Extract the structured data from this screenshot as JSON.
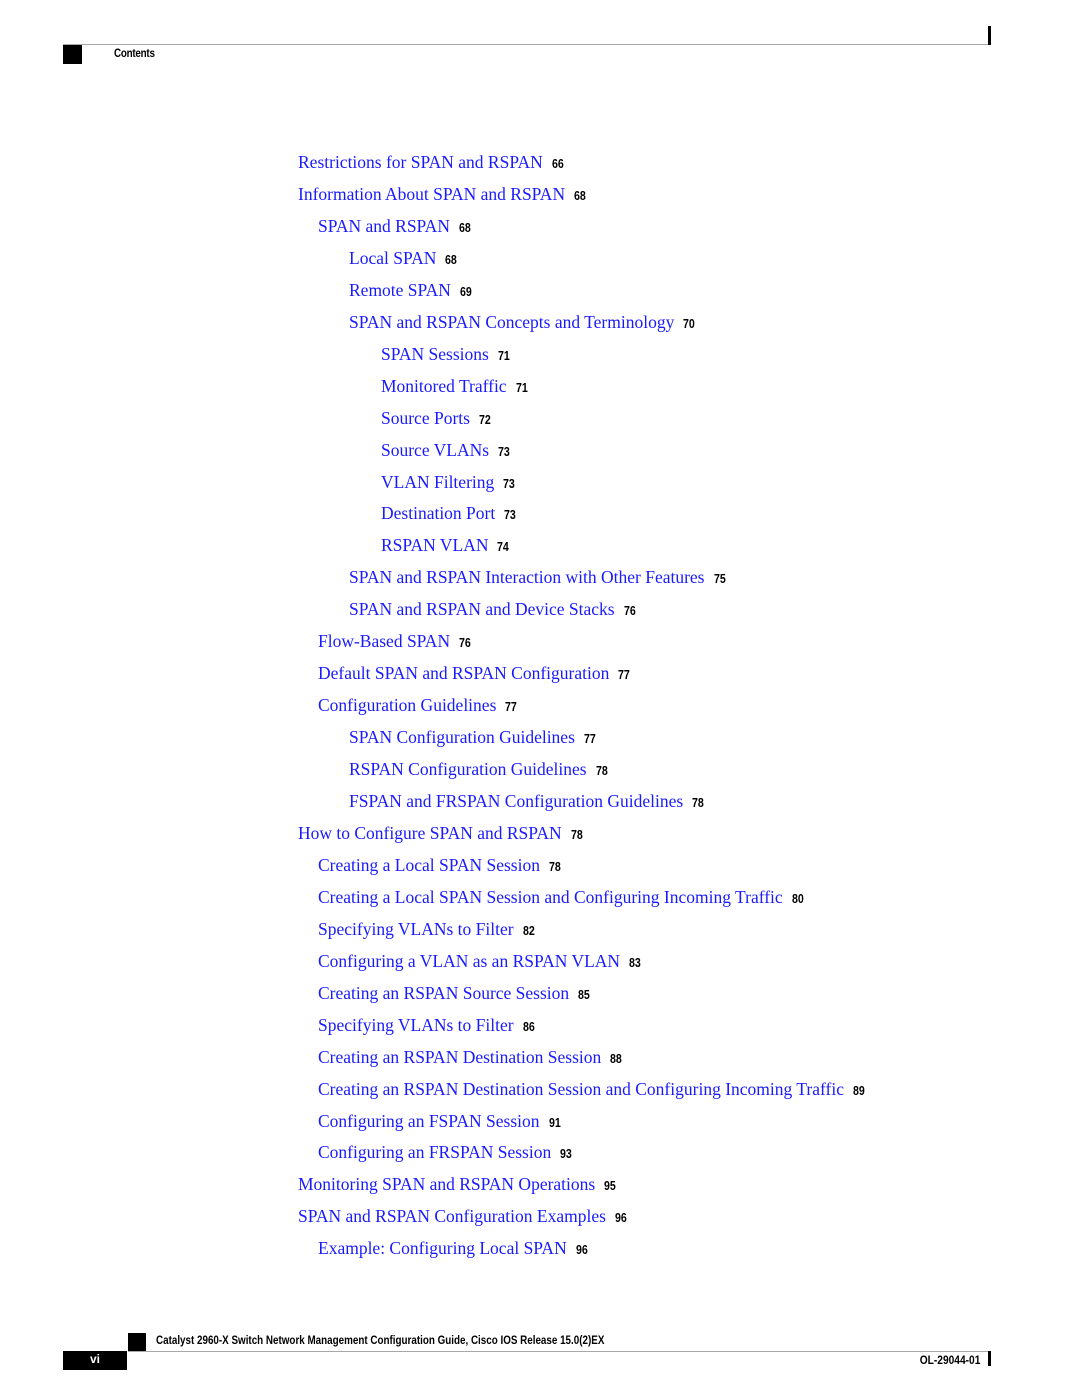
{
  "header": {
    "section_title": "Contents"
  },
  "toc": {
    "entries": [
      {
        "level": 1,
        "label": "Restrictions for SPAN and RSPAN",
        "page": "66"
      },
      {
        "level": 1,
        "label": "Information About SPAN and RSPAN",
        "page": "68"
      },
      {
        "level": 2,
        "label": "SPAN and RSPAN",
        "page": "68"
      },
      {
        "level": 3,
        "label": "Local SPAN",
        "page": "68"
      },
      {
        "level": 3,
        "label": "Remote SPAN",
        "page": "69"
      },
      {
        "level": 3,
        "label": "SPAN and RSPAN Concepts and Terminology",
        "page": "70"
      },
      {
        "level": 4,
        "label": "SPAN Sessions",
        "page": "71"
      },
      {
        "level": 4,
        "label": "Monitored Traffic",
        "page": "71"
      },
      {
        "level": 4,
        "label": "Source Ports",
        "page": "72"
      },
      {
        "level": 4,
        "label": "Source VLANs",
        "page": "73"
      },
      {
        "level": 4,
        "label": "VLAN Filtering",
        "page": "73"
      },
      {
        "level": 4,
        "label": "Destination Port",
        "page": "73"
      },
      {
        "level": 4,
        "label": "RSPAN VLAN",
        "page": "74"
      },
      {
        "level": 3,
        "label": "SPAN and RSPAN Interaction with Other Features",
        "page": "75"
      },
      {
        "level": 3,
        "label": "SPAN and RSPAN and Device Stacks",
        "page": "76"
      },
      {
        "level": 2,
        "label": "Flow-Based SPAN",
        "page": "76"
      },
      {
        "level": 2,
        "label": "Default SPAN and RSPAN Configuration",
        "page": "77"
      },
      {
        "level": 2,
        "label": "Configuration Guidelines",
        "page": "77"
      },
      {
        "level": 3,
        "label": "SPAN Configuration Guidelines",
        "page": "77"
      },
      {
        "level": 3,
        "label": "RSPAN Configuration Guidelines",
        "page": "78"
      },
      {
        "level": 3,
        "label": "FSPAN and FRSPAN Configuration Guidelines",
        "page": "78"
      },
      {
        "level": 1,
        "label": "How to Configure SPAN and RSPAN",
        "page": "78"
      },
      {
        "level": 2,
        "label": "Creating a Local SPAN Session",
        "page": "78"
      },
      {
        "level": 2,
        "label": "Creating a Local SPAN Session and Configuring Incoming Traffic",
        "page": "80"
      },
      {
        "level": 2,
        "label": "Specifying VLANs to Filter",
        "page": "82"
      },
      {
        "level": 2,
        "label": "Configuring a VLAN as an RSPAN VLAN",
        "page": "83"
      },
      {
        "level": 2,
        "label": "Creating an RSPAN Source Session",
        "page": "85"
      },
      {
        "level": 2,
        "label": "Specifying VLANs to Filter",
        "page": "86"
      },
      {
        "level": 2,
        "label": "Creating an RSPAN Destination Session",
        "page": "88"
      },
      {
        "level": 2,
        "label": "Creating an RSPAN Destination Session and Configuring Incoming Traffic",
        "page": "89"
      },
      {
        "level": 2,
        "label": "Configuring an FSPAN Session",
        "page": "91"
      },
      {
        "level": 2,
        "label": "Configuring an FRSPAN Session",
        "page": "93"
      },
      {
        "level": 1,
        "label": "Monitoring SPAN and RSPAN Operations",
        "page": "95"
      },
      {
        "level": 1,
        "label": "SPAN and RSPAN Configuration Examples",
        "page": "96"
      },
      {
        "level": 2,
        "label": "Example: Configuring Local SPAN",
        "page": "96"
      }
    ]
  },
  "footer": {
    "guide_title": "Catalyst 2960-X Switch Network Management Configuration Guide, Cisco IOS Release 15.0(2)EX",
    "page_number": "vi",
    "doc_number": "OL-29044-01"
  },
  "colors": {
    "link": "#1a1aff",
    "text": "#000000",
    "rule": "#a8a8a8"
  }
}
